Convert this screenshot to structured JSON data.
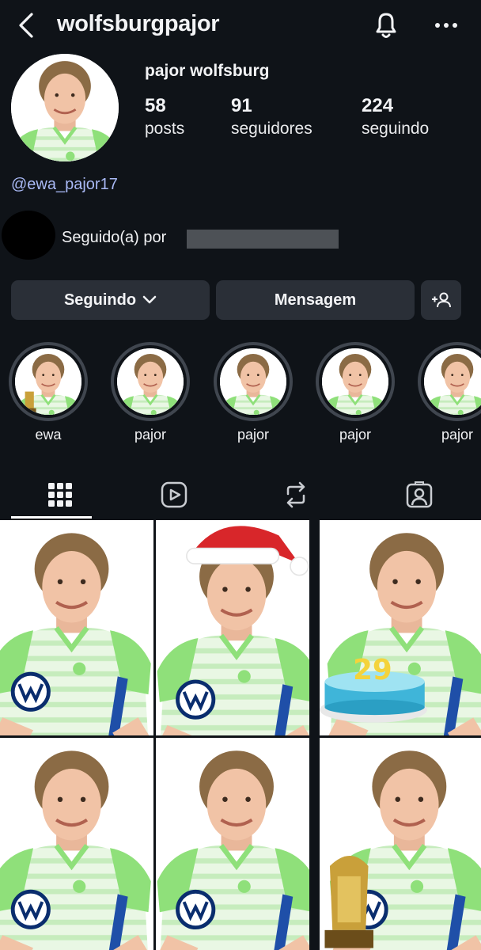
{
  "header": {
    "username": "wolfsburgpajor",
    "back_icon": "chevron-left-icon",
    "bell_icon": "bell-icon",
    "more_icon": "more-horizontal-icon"
  },
  "profile": {
    "display_name": "pajor wolfsburg",
    "stats": [
      {
        "value": "58",
        "label": "posts"
      },
      {
        "value": "91",
        "label": "seguidores"
      },
      {
        "value": "224",
        "label": "seguindo"
      }
    ],
    "bio_link": "@ewa_pajor17",
    "followed_by": "Seguido(a) por"
  },
  "actions": {
    "following_label": "Seguindo",
    "message_label": "Mensagem",
    "add_user_icon": "add-user-icon"
  },
  "highlights": [
    {
      "label": "ewa"
    },
    {
      "label": "pajor"
    },
    {
      "label": "pajor"
    },
    {
      "label": "pajor"
    },
    {
      "label": "pajor"
    }
  ],
  "tabs": [
    {
      "icon": "grid-icon",
      "active": true
    },
    {
      "icon": "reels-icon",
      "active": false
    },
    {
      "icon": "reposts-icon",
      "active": false
    },
    {
      "icon": "tagged-icon",
      "active": false
    }
  ],
  "posts": [
    {
      "variant": "plain"
    },
    {
      "variant": "santa-hat"
    },
    {
      "variant": "birthday-cake",
      "cake_number": "29"
    },
    {
      "variant": "plain"
    },
    {
      "variant": "plain"
    },
    {
      "variant": "trophy"
    }
  ],
  "colors": {
    "background": "#0f1318",
    "button": "#2a2f37",
    "link": "#a9b9f5",
    "jersey_green": "#8fe07a",
    "vw_blue": "#0a2d6e"
  }
}
